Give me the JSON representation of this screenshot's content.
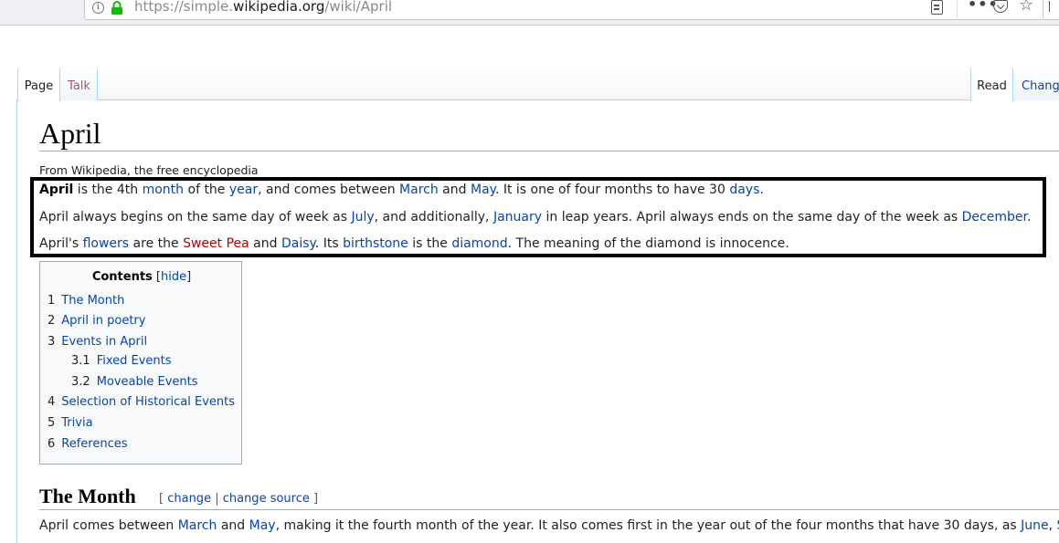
{
  "browser": {
    "url_prefix": "https://simple.",
    "url_domain": "wikipedia.org",
    "url_path": "/wiki/April",
    "info_glyph": "i",
    "more_glyph": "•••",
    "star_glyph": "☆"
  },
  "tabs": {
    "page": "Page",
    "talk": "Talk",
    "read": "Read",
    "change": "Change"
  },
  "article": {
    "title": "April",
    "tagline": "From Wikipedia, the free encyclopedia",
    "p1": {
      "bold": "April",
      "t1": " is the 4th ",
      "l_month": "month",
      "t2": " of the ",
      "l_year": "year",
      "t3": ", and comes between ",
      "l_march": "March",
      "t4": " and ",
      "l_may": "May",
      "t5": ". It is one of four months to have 30 ",
      "l_days": "days",
      "t6": "."
    },
    "p2": {
      "t1": "April always begins on the same day of week as ",
      "l_july": "July",
      "t2": ", and additionally, ",
      "l_january": "January",
      "t3": " in leap years. April always ends on the same day of the week as ",
      "l_december": "December",
      "t4": "."
    },
    "p3": {
      "t1": "April's ",
      "l_flowers": "flowers",
      "t2": " are the ",
      "l_sweetpea": "Sweet Pea",
      "t3": " and ",
      "l_daisy": "Daisy",
      "t4": ". Its ",
      "l_birthstone": "birthstone",
      "t5": " is the ",
      "l_diamond": "diamond",
      "t6": ". The meaning of the diamond is innocence."
    }
  },
  "toc": {
    "title": "Contents",
    "hide_open": "[",
    "hide": "hide",
    "hide_close": "]",
    "items": [
      {
        "num": "1",
        "label": "The Month"
      },
      {
        "num": "2",
        "label": "April in poetry"
      },
      {
        "num": "3",
        "label": "Events in April"
      },
      {
        "num": "3.1",
        "label": "Fixed Events"
      },
      {
        "num": "3.2",
        "label": "Moveable Events"
      },
      {
        "num": "4",
        "label": "Selection of Historical Events"
      },
      {
        "num": "5",
        "label": "Trivia"
      },
      {
        "num": "6",
        "label": "References"
      }
    ]
  },
  "section": {
    "heading": "The Month",
    "edit_open": "[ ",
    "edit_change": "change",
    "edit_sep": " | ",
    "edit_source": "change source",
    "edit_close": " ]",
    "p4": {
      "t1": "April comes between ",
      "l_march": "March",
      "t2": " and ",
      "l_may": "May",
      "t3": ", making it the fourth month of the year. It also comes first in the year out of the four months that have 30 days, as ",
      "l_june": "June",
      "t4": ", ",
      "l_next": "S"
    }
  },
  "colors": {
    "link": "#0645ad",
    "redlink": "#ba0000",
    "talk_tab": "#a55858",
    "lock": "#12bc00",
    "highlight_border": "#000000"
  }
}
